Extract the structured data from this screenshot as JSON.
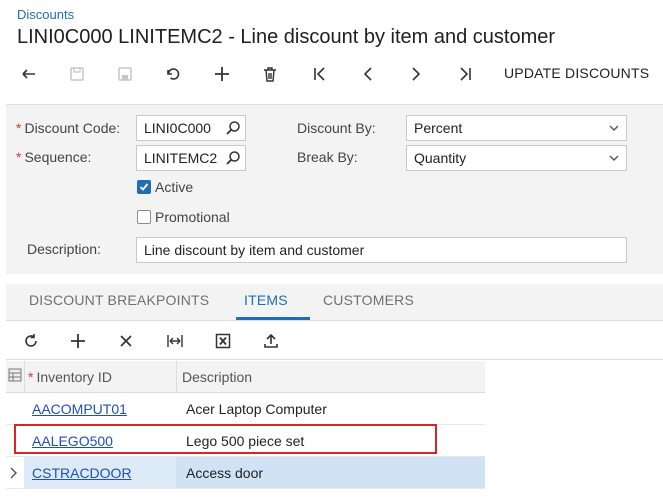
{
  "breadcrumb": "Discounts",
  "title": "LINI0C000 LINITEMC2 - Line discount by item and customer",
  "toolbar": {
    "buttons": [
      "back-icon",
      "copy-icon",
      "save-icon",
      "undo-icon",
      "add-icon",
      "delete-icon",
      "first-icon",
      "prev-icon",
      "next-icon",
      "last-icon"
    ],
    "update_discounts": "UPDATE DISCOUNTS"
  },
  "form": {
    "discount_code_label": "Discount Code:",
    "discount_code_value": "LINI0C000",
    "sequence_label": "Sequence:",
    "sequence_value": "LINITEMC2",
    "active_label": "Active",
    "active_checked": true,
    "promotional_label": "Promotional",
    "promotional_checked": false,
    "description_label": "Description:",
    "description_value": "Line discount by item and customer",
    "discount_by_label": "Discount By:",
    "discount_by_value": "Percent",
    "break_by_label": "Break By:",
    "break_by_value": "Quantity",
    "required_marker": "*"
  },
  "tabs": [
    {
      "label": "DISCOUNT BREAKPOINTS",
      "active": false
    },
    {
      "label": "ITEMS",
      "active": true
    },
    {
      "label": "CUSTOMERS",
      "active": false
    }
  ],
  "grid": {
    "toolbar": [
      "refresh-icon",
      "add-icon",
      "delete-icon",
      "fit-columns-icon",
      "export-excel-icon",
      "upload-icon"
    ],
    "columns": [
      "Inventory ID",
      "Description"
    ],
    "rows": [
      {
        "inventory_id": "AACOMPUT01",
        "description": "Acer Laptop Computer"
      },
      {
        "inventory_id": "AALEGO500",
        "description": "Lego 500 piece set"
      },
      {
        "inventory_id": "CSTRACDOOR",
        "description": "Access door"
      }
    ]
  },
  "colors": {
    "accent": "#1f6fb5",
    "link": "#1f4fb8",
    "highlight": "#d9252a",
    "selected_row": "#dcebf7"
  }
}
